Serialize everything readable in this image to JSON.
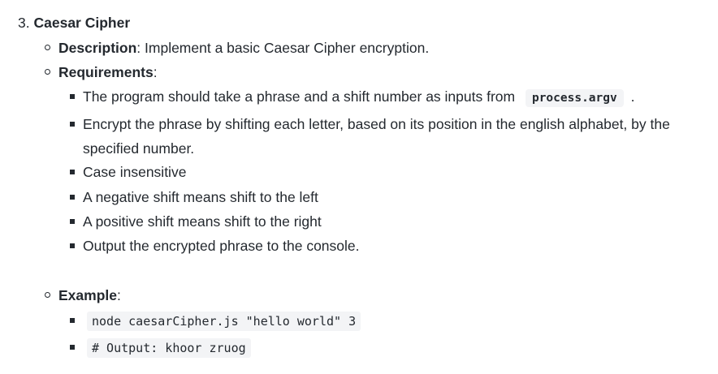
{
  "section": {
    "number": "3.",
    "title": "Caesar Cipher"
  },
  "description": {
    "label": "Description",
    "colon": ":",
    "text": " Implement a basic Caesar Cipher encryption."
  },
  "requirements": {
    "label": "Requirements",
    "colon": ":",
    "items": [
      {
        "prefix": "The program should take a phrase and a shift number as inputs from",
        "code": "process.argv",
        "suffix": "."
      },
      {
        "line1": "Encrypt the phrase by shifting each letter, based on its position in the english alphabet, by the",
        "line2": "specified number."
      },
      {
        "text": "Case insensitive"
      },
      {
        "text": "A negative shift means shift to the left"
      },
      {
        "text": "A positive shift means shift to the right"
      },
      {
        "text": "Output the encrypted phrase to the console."
      }
    ]
  },
  "example": {
    "label": "Example",
    "colon": ":",
    "items": [
      {
        "code": "node caesarCipher.js \"hello world\" 3"
      },
      {
        "code": "# Output: khoor zruog"
      }
    ]
  }
}
